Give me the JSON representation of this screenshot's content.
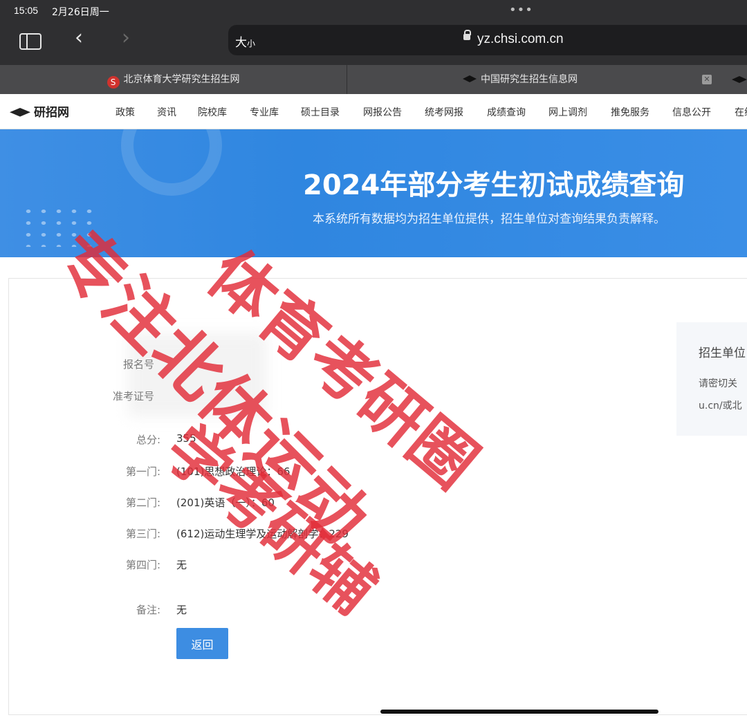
{
  "status_bar": {
    "time": "15:05",
    "date": "2月26日周一"
  },
  "browser": {
    "address_size_label": "大",
    "address_size_small": "小",
    "url": "yz.chsi.com.cn"
  },
  "tabs": [
    {
      "title": "北京体育大学研究生招生网"
    },
    {
      "title": "中国研究生招生信息网"
    }
  ],
  "site": {
    "logo": "研招网",
    "nav": [
      "政策",
      "资讯",
      "院校库",
      "专业库",
      "硕士目录",
      "网报公告",
      "统考网报",
      "成绩查询",
      "网上调剂",
      "推免服务",
      "信息公开",
      "在线"
    ]
  },
  "banner": {
    "title": "2024年部分考生初试成绩查询",
    "subtitle": "本系统所有数据均为招生单位提供，招生单位对查询结果负责解释。"
  },
  "result": {
    "reg_label": "报名号",
    "ticket_label": "准考证号",
    "total_label": "总分:",
    "total_value": "355",
    "subjects": [
      {
        "label": "第一门:",
        "value": "(101)思想政治理论：66"
      },
      {
        "label": "第二门:",
        "value": "(201)英语（一）：60"
      },
      {
        "label": "第三门:",
        "value": "(612)运动生理学及运动解剖学：229"
      },
      {
        "label": "第四门:",
        "value": "无"
      }
    ],
    "remark_label": "备注:",
    "remark_value": "无",
    "back_button": "返回"
  },
  "sidebox": {
    "title": "招生单位",
    "line1": "请密切关",
    "line2": "u.cn/或北"
  },
  "watermark": {
    "line1": "专注北体运动",
    "line2": "体育考研圈",
    "line3": "学考研辅"
  },
  "colors": {
    "banner_blue": "#2f86e0",
    "button_blue": "#3d8de2",
    "watermark_red": "#e22c38"
  }
}
